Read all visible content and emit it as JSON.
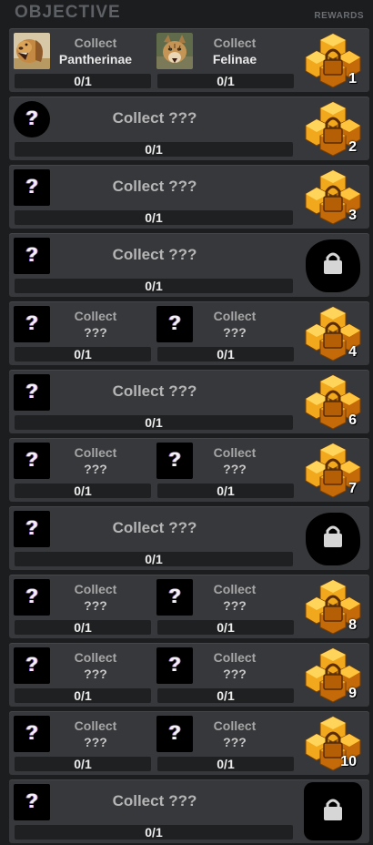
{
  "header": {
    "title": "OBJECTIVE",
    "rewards_label": "REWARDS"
  },
  "rows": [
    {
      "kind": "double",
      "reward": "1",
      "locked": false,
      "items": [
        {
          "line1": "Collect",
          "line2": "Pantherinae",
          "progress": "0/1",
          "known": true,
          "image": "lion-photo"
        },
        {
          "line1": "Collect",
          "line2": "Felinae",
          "progress": "0/1",
          "known": true,
          "image": "cat-photo"
        }
      ]
    },
    {
      "kind": "single",
      "reward": "2",
      "locked": false,
      "round": true,
      "items": [
        {
          "line1": "Collect",
          "line2": "???",
          "progress": "0/1"
        }
      ]
    },
    {
      "kind": "single",
      "reward": "3",
      "locked": false,
      "items": [
        {
          "line1": "Collect",
          "line2": "???",
          "progress": "0/1"
        }
      ]
    },
    {
      "kind": "single",
      "reward": "",
      "locked": true,
      "lockshape": "blob",
      "items": [
        {
          "line1": "Collect",
          "line2": "???",
          "progress": "0/1"
        }
      ]
    },
    {
      "kind": "double",
      "reward": "4",
      "locked": false,
      "items": [
        {
          "line1": "Collect",
          "line2": "???",
          "progress": "0/1"
        },
        {
          "line1": "Collect",
          "line2": "???",
          "progress": "0/1"
        }
      ]
    },
    {
      "kind": "single",
      "reward": "6",
      "locked": false,
      "items": [
        {
          "line1": "Collect",
          "line2": "???",
          "progress": "0/1"
        }
      ]
    },
    {
      "kind": "double",
      "reward": "7",
      "locked": false,
      "items": [
        {
          "line1": "Collect",
          "line2": "???",
          "progress": "0/1"
        },
        {
          "line1": "Collect",
          "line2": "???",
          "progress": "0/1"
        }
      ]
    },
    {
      "kind": "single",
      "reward": "",
      "locked": true,
      "lockshape": "blob",
      "items": [
        {
          "line1": "Collect",
          "line2": "???",
          "progress": "0/1"
        }
      ]
    },
    {
      "kind": "double",
      "reward": "8",
      "locked": false,
      "items": [
        {
          "line1": "Collect",
          "line2": "???",
          "progress": "0/1"
        },
        {
          "line1": "Collect",
          "line2": "???",
          "progress": "0/1"
        }
      ]
    },
    {
      "kind": "double",
      "reward": "9",
      "locked": false,
      "items": [
        {
          "line1": "Collect",
          "line2": "???",
          "progress": "0/1"
        },
        {
          "line1": "Collect",
          "line2": "???",
          "progress": "0/1"
        }
      ]
    },
    {
      "kind": "double",
      "reward": "10",
      "locked": false,
      "items": [
        {
          "line1": "Collect",
          "line2": "???",
          "progress": "0/1"
        },
        {
          "line1": "Collect",
          "line2": "???",
          "progress": "0/1"
        }
      ]
    },
    {
      "kind": "single",
      "reward": "",
      "locked": true,
      "lockshape": "square",
      "items": [
        {
          "line1": "Collect",
          "line2": "???",
          "progress": "0/1"
        }
      ]
    }
  ],
  "colors": {
    "reward_gold": "#f2a81c",
    "reward_dark": "#c46a08",
    "lock_gray": "#d6d6d6"
  },
  "icons": {
    "unknown": "question-mark-icon",
    "reward": "gold-cube-reward-icon",
    "lock": "padlock-icon"
  }
}
